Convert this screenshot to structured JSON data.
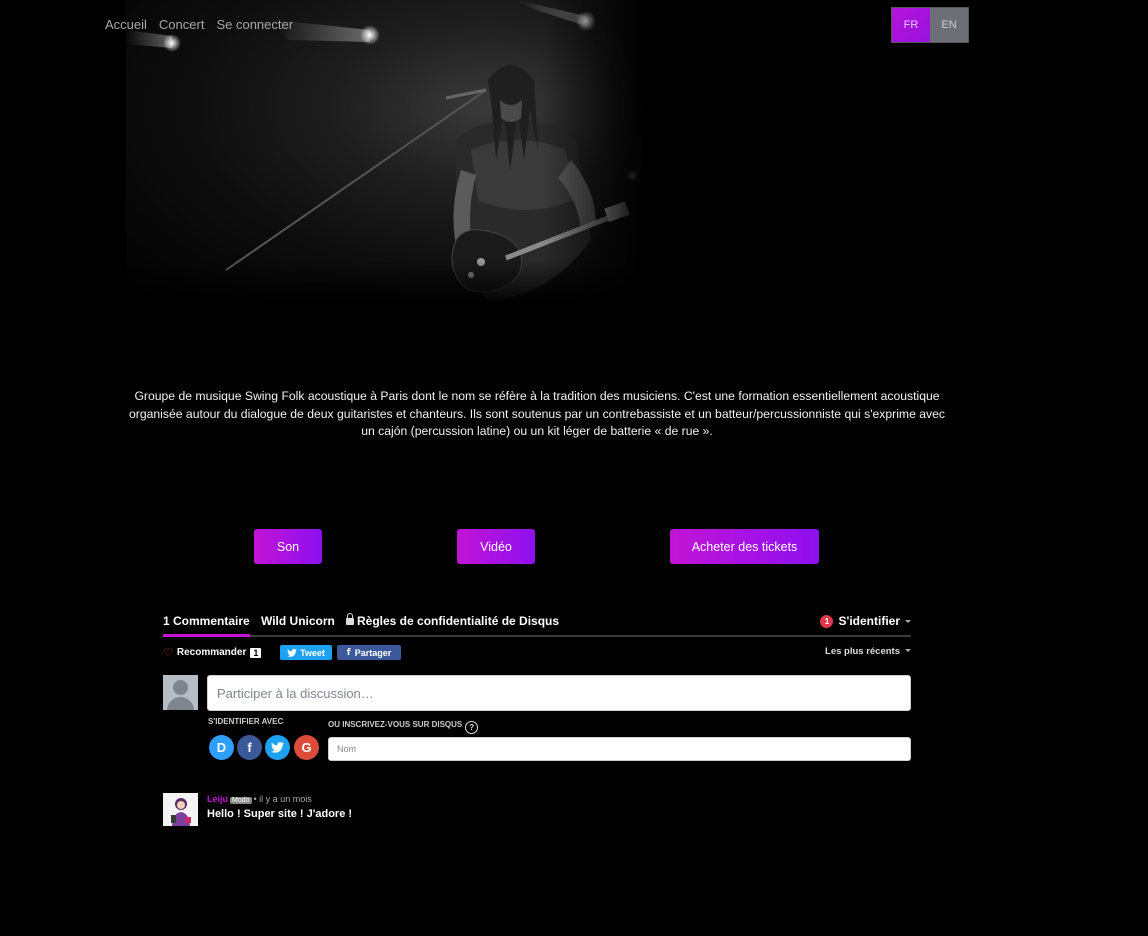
{
  "nav": {
    "links": [
      "Accueil",
      "Concert",
      "Se connecter"
    ]
  },
  "lang": {
    "fr": "FR",
    "en": "EN",
    "active": "FR"
  },
  "description": "Groupe de musique Swing Folk acoustique à Paris dont le nom se réfère à la tradition des musiciens. C'est une formation essentiellement acoustique organisée autour du dialogue de deux guitaristes et chanteurs. Ils sont soutenus par un contrebassiste et un batteur/percussionniste qui s'exprime avec un cajón (percussion latine) ou un kit léger de batterie « de rue ».",
  "actions": {
    "son": "Son",
    "video": "Vidéo",
    "tickets": "Acheter des tickets"
  },
  "disqus": {
    "tabs": {
      "comments": "1 Commentaire",
      "community": "Wild Unicorn",
      "privacy": "Règles de confidentialité de Disqus"
    },
    "login": {
      "badge": "1",
      "label": "S'identifier"
    },
    "recommend": {
      "label": "Recommander",
      "count": "1"
    },
    "tweet": "Tweet",
    "share": "Partager",
    "sort": "Les plus récents",
    "input_placeholder": "Participer à la discussion…",
    "login_with": "S'IDENTIFIER AVEC",
    "or_signup": "OU INSCRIVEZ-VOUS SUR DISQUS",
    "help": "?",
    "name_placeholder": "Nom",
    "social": {
      "disqus": "D",
      "facebook": "f",
      "twitter": "t",
      "google": "G"
    },
    "comment": {
      "author": "Leiju",
      "role": "Modo",
      "time": "• il y a un mois",
      "text": "Hello ! Super site ! J'adore !"
    }
  },
  "colors": {
    "accent_start": "#c214d6",
    "accent_end": "#8d10ef",
    "background": "#000000",
    "twitter": "#1da1f2",
    "facebook": "#3b5998",
    "google": "#dd4b39",
    "disqus": "#2e9fff"
  }
}
